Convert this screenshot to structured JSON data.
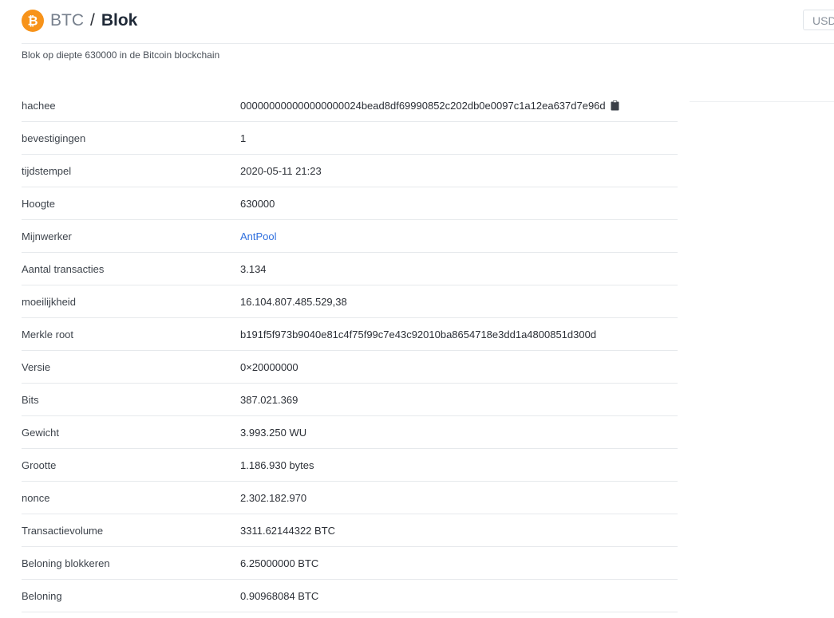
{
  "header": {
    "breadcrumb_root": "BTC",
    "breadcrumb_separator": "/",
    "breadcrumb_current": "Blok",
    "currency": "USD"
  },
  "subtitle": "Blok op diepte 630000 in de Bitcoin blockchain",
  "colors": {
    "brand": "#f7931a",
    "link": "#2f6fde"
  },
  "icons": {
    "logo": "bitcoin-logo-icon",
    "copy": "clipboard-icon"
  },
  "details": {
    "hash": {
      "label": "hachee",
      "value": "000000000000000000024bead8df69990852c202db0e0097c1a12ea637d7e96d"
    },
    "confirmations": {
      "label": "bevestigingen",
      "value": "1"
    },
    "timestamp": {
      "label": "tijdstempel",
      "value": "2020-05-11 21:23"
    },
    "height": {
      "label": "Hoogte",
      "value": "630000"
    },
    "miner": {
      "label": "Mijnwerker",
      "value": "AntPool"
    },
    "tx_count": {
      "label": "Aantal transacties",
      "value": "3.134"
    },
    "difficulty": {
      "label": "moeilijkheid",
      "value": "16.104.807.485.529,38"
    },
    "merkle_root": {
      "label": "Merkle root",
      "value": "b191f5f973b9040e81c4f75f99c7e43c92010ba8654718e3dd1a4800851d300d"
    },
    "version": {
      "label": "Versie",
      "value": "0×20000000"
    },
    "bits": {
      "label": "Bits",
      "value": "387.021.369"
    },
    "weight": {
      "label": "Gewicht",
      "value": "3.993.250 WU"
    },
    "size": {
      "label": "Grootte",
      "value": "1.186.930 bytes"
    },
    "nonce": {
      "label": "nonce",
      "value": "2.302.182.970"
    },
    "tx_volume": {
      "label": "Transactievolume",
      "value": "3311.62144322 BTC"
    },
    "block_reward": {
      "label": "Beloning blokkeren",
      "value": "6.25000000 BTC"
    },
    "fee_reward": {
      "label": "Beloning",
      "value": "0.90968084 BTC"
    }
  }
}
